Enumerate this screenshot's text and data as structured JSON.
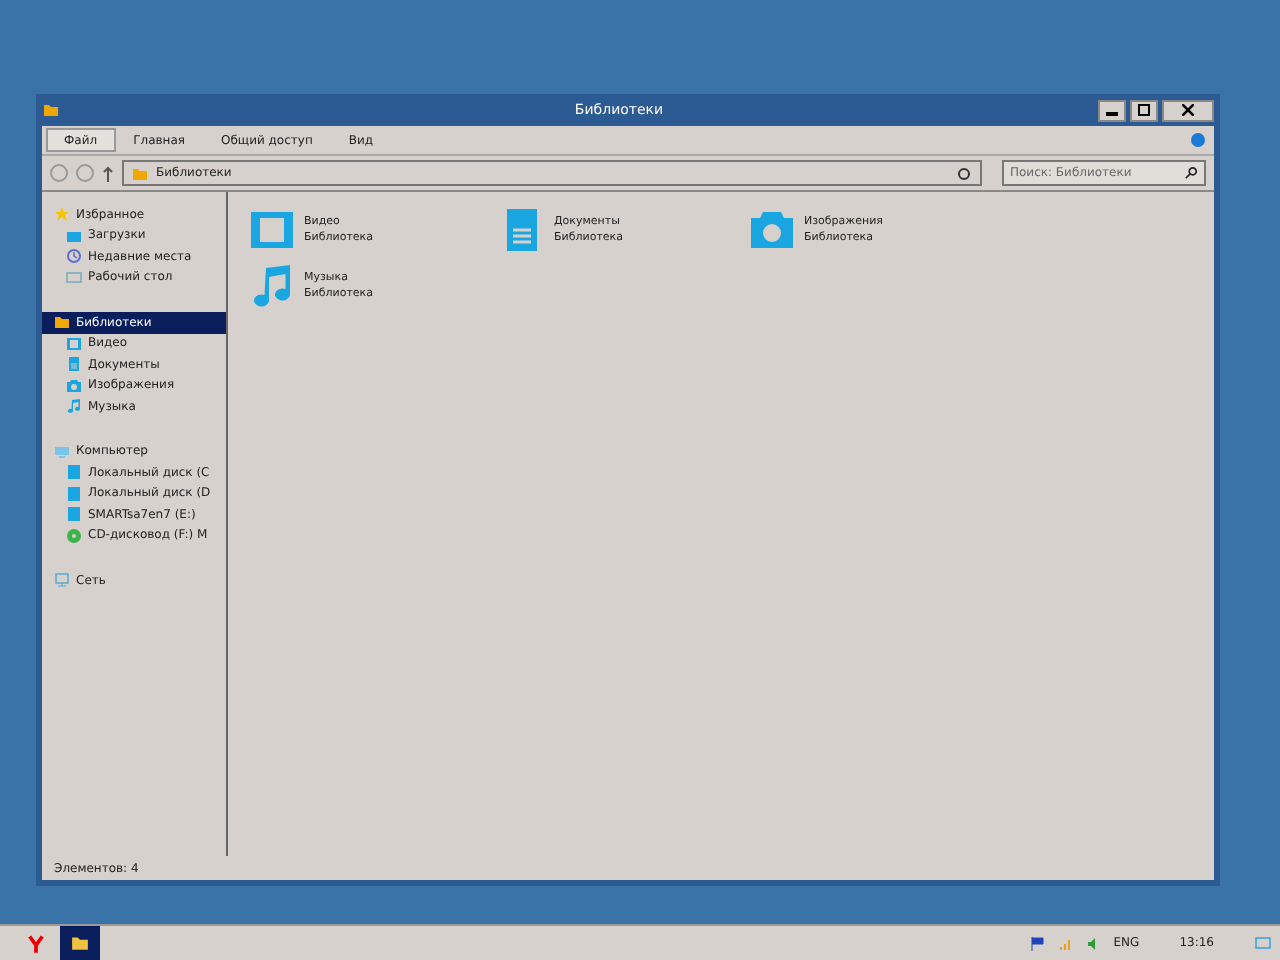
{
  "window": {
    "title": "Библиотеки"
  },
  "ribbon_tabs": [
    {
      "label": "Файл",
      "selected": true
    },
    {
      "label": "Главная",
      "selected": false
    },
    {
      "label": "Общий доступ",
      "selected": false
    },
    {
      "label": "Вид",
      "selected": false
    }
  ],
  "address": {
    "path": "Библиотеки"
  },
  "search": {
    "placeholder": "Поиск: Библиотеки"
  },
  "sidebar": {
    "groups": [
      {
        "label": "Избранное",
        "selected": false,
        "children": [
          {
            "label": "Загрузки",
            "selected": false
          },
          {
            "label": "Недавние места",
            "selected": false
          },
          {
            "label": "Рабочий стол",
            "selected": false
          }
        ]
      },
      {
        "label": "Библиотеки",
        "selected": true,
        "children": [
          {
            "label": "Видео",
            "selected": false
          },
          {
            "label": "Документы",
            "selected": false
          },
          {
            "label": "Изображения",
            "selected": false
          },
          {
            "label": "Музыка",
            "selected": false
          }
        ]
      },
      {
        "label": "Компьютер",
        "selected": false,
        "children": [
          {
            "label": "Локальный диск (C",
            "selected": false
          },
          {
            "label": "Локальный диск (D",
            "selected": false
          },
          {
            "label": "SMARTsa7en7 (E:)",
            "selected": false
          },
          {
            "label": "CD-дисковод (F:) M",
            "selected": false
          }
        ]
      },
      {
        "label": "Сеть",
        "selected": false
      }
    ]
  },
  "libraries": [
    {
      "name": "Видео",
      "type": "Библиотека"
    },
    {
      "name": "Документы",
      "type": "Библиотека"
    },
    {
      "name": "Изображения",
      "type": "Библиотека"
    },
    {
      "name": "Музыка",
      "type": "Библиотека"
    }
  ],
  "status_bar": {
    "count": "Элементов: 4"
  },
  "taskbar": {
    "language": "ENG",
    "time": "13:16"
  }
}
